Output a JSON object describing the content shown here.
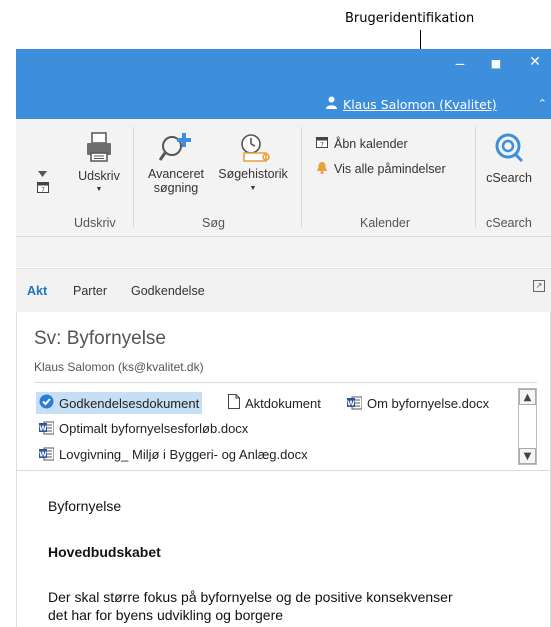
{
  "callout": {
    "label": "Brugeridentifikation"
  },
  "window": {
    "user_name": "Klaus Salomon (Kvalitet)",
    "btn_minimize": "‒",
    "btn_maximize": "■",
    "btn_close": "✕",
    "collapse": "⌃"
  },
  "ribbon": {
    "print_label": "Udskriv",
    "print_group": "Udskriv",
    "adv_search_label_1": "Avanceret",
    "adv_search_label_2": "søgning",
    "history_label": "Søgehistorik",
    "search_group": "Søg",
    "open_calendar": "Åbn kalender",
    "show_reminders": "Vis alle påmindelser",
    "calendar_group": "Kalender",
    "csearch_label": "cSearch",
    "csearch_group": "cSearch"
  },
  "tabs": [
    {
      "label": "Akt"
    },
    {
      "label": "Parter"
    },
    {
      "label": "Godkendelse"
    }
  ],
  "message": {
    "subject": "Sv: Byfornyelse",
    "sender": "Klaus Salomon (ks@kvalitet.dk)"
  },
  "attachments": [
    {
      "name": "Godkendelsesdokument",
      "icon": "check-circle-icon"
    },
    {
      "name": "Aktdokument",
      "icon": "document-icon"
    },
    {
      "name": "Om byfornyelse.docx",
      "icon": "word-icon"
    },
    {
      "name": "Optimalt byfornyelsesforløb.docx",
      "icon": "word-icon"
    },
    {
      "name": "Lovgivning_ Miljø i Byggeri- og Anlæg.docx",
      "icon": "word-icon"
    }
  ],
  "body": {
    "line1": "Byfornyelse",
    "heading": "Hovedbudskabet",
    "para_1": "Der skal større fokus på byfornyelse og de positive konsekvenser",
    "para_2": "det har for byens udvikling og borgere"
  },
  "colors": {
    "accent": "#3d8edb",
    "tab_active": "#1e73be",
    "selection": "#c7dff5"
  }
}
